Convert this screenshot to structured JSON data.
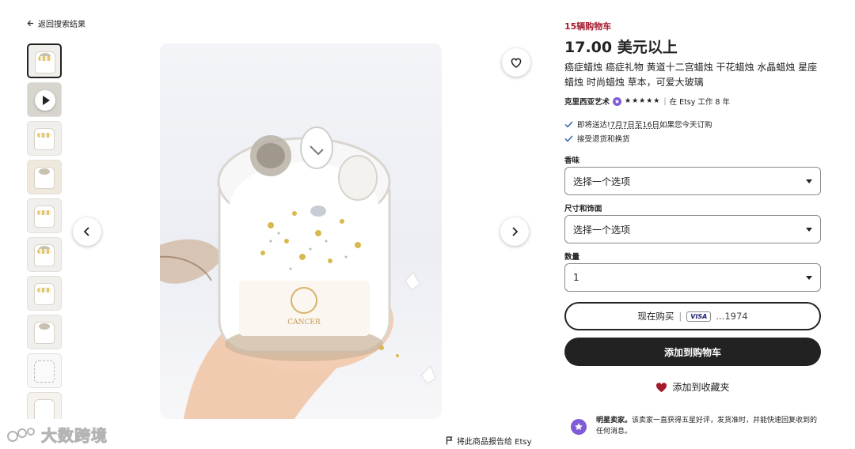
{
  "back_link": {
    "label": "返回搜索结果"
  },
  "gallery": {
    "thumbnails_count": 10,
    "video_thumbnail_index": 1,
    "active_index": 0
  },
  "actions": {
    "report_label": "将此商品报告给 Etsy"
  },
  "watermark": {
    "text": "大数跨境"
  },
  "listing": {
    "cart_note": "15辆购物车",
    "price": "17.00 美元以上",
    "title": "癌症蜡烛 癌症礼物 黄道十二宫蜡烛 干花蜡烛 水晶蜡烛 星座蜡烛 时尚蜡烛 草本，可爱大玻璃",
    "shop": {
      "name": "克里西亚艺术",
      "stars": "★★★★★",
      "tenure": "在 Etsy 工作 8 年"
    },
    "perks": {
      "shipping_prefix": "即将送达!",
      "shipping_dates": "7月7日至16日",
      "shipping_suffix": "如果您今天订购",
      "returns": "接受退货和换货"
    }
  },
  "options": {
    "scent_label": "香味",
    "scent_value": "选择一个选项",
    "size_label": "尺寸和饰面",
    "size_value": "选择一个选项",
    "qty_label": "数量",
    "qty_value": "1"
  },
  "buttons": {
    "buy_now": "现在购买",
    "card_brand": "VISA",
    "card_last4": "...1974",
    "add_to_cart": "添加到购物车",
    "add_to_favorites": "添加到收藏夹"
  },
  "star_seller": {
    "title": "明星卖家。",
    "text": "该卖家一直获得五星好评，发货准时，并能快速回复收到的任何消息。"
  },
  "colors": {
    "accent_red": "#a61a2e",
    "star_seller_purple": "#7f5bd6",
    "primary_button": "#222222",
    "heart": "#a61a2e"
  },
  "icons": [
    "arrow-left-icon",
    "play-icon",
    "heart-outline-icon",
    "chevron-left-icon",
    "chevron-right-icon",
    "flag-icon",
    "check-icon",
    "caret-down-icon",
    "heart-filled-icon",
    "star-badge-icon"
  ]
}
